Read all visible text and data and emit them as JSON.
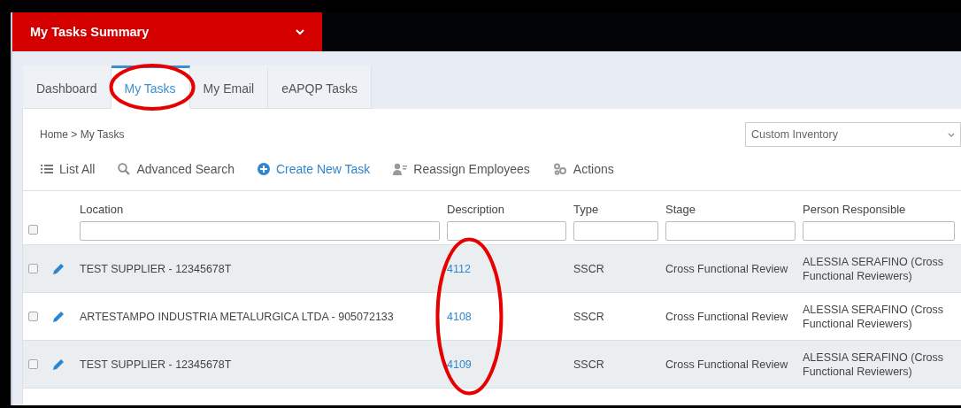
{
  "header": {
    "title": "My Tasks Summary"
  },
  "tabs": [
    {
      "label": "Dashboard",
      "selected": false,
      "circled": false
    },
    {
      "label": "My Tasks",
      "selected": true,
      "circled": true
    },
    {
      "label": "My Email",
      "selected": false,
      "circled": false
    },
    {
      "label": "eAPQP Tasks",
      "selected": false,
      "circled": false
    }
  ],
  "breadcrumb": "Home > My Tasks",
  "view_select": {
    "value": "Custom Inventory"
  },
  "toolbar": [
    {
      "label": "List All",
      "kind": "list"
    },
    {
      "label": "Advanced Search",
      "kind": "search"
    },
    {
      "label": "Create New Task",
      "kind": "create"
    },
    {
      "label": "Reassign Employees",
      "kind": "reassign"
    },
    {
      "label": "Actions",
      "kind": "actions"
    }
  ],
  "table": {
    "columns": [
      "Location",
      "Description",
      "Type",
      "Stage",
      "Person Responsible"
    ],
    "select_all_checked": false,
    "description_circled": true,
    "rows": [
      {
        "checked": false,
        "location": "TEST SUPPLIER - 12345678T",
        "description": "4112",
        "type": "SSCR",
        "stage": "Cross Functional Review",
        "person": "ALESSIA SERAFINO (Cross Functional Reviewers)"
      },
      {
        "checked": false,
        "location": "ARTESTAMPO INDUSTRIA METALURGICA LTDA - 905072133",
        "description": "4108",
        "type": "SSCR",
        "stage": "Cross Functional Review",
        "person": "ALESSIA SERAFINO (Cross Functional Reviewers)"
      },
      {
        "checked": false,
        "location": "TEST SUPPLIER - 12345678T",
        "description": "4109",
        "type": "SSCR",
        "stage": "Cross Functional Review",
        "person": "ALESSIA SERAFINO (Cross Functional Reviewers)"
      }
    ]
  }
}
